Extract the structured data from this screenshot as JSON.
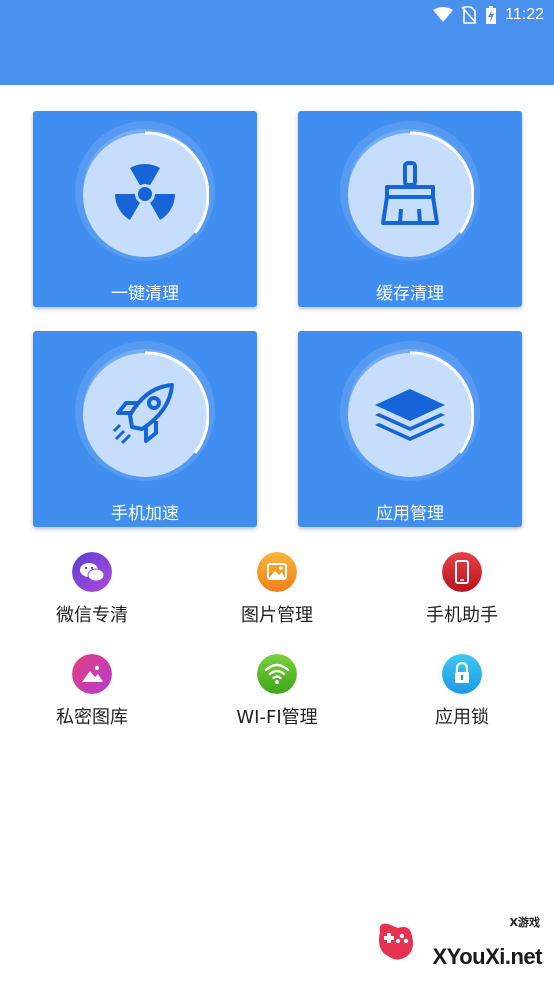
{
  "status_bar": {
    "time": "11:22",
    "background": "#4a90ef",
    "icons": [
      "wifi-icon",
      "no-sim-icon",
      "battery-charging-icon"
    ]
  },
  "main_cards": [
    {
      "label": "一键清理",
      "icon": "radiation-icon"
    },
    {
      "label": "缓存清理",
      "icon": "broom-icon"
    },
    {
      "label": "手机加速",
      "icon": "rocket-icon"
    },
    {
      "label": "应用管理",
      "icon": "layers-icon"
    }
  ],
  "tools": [
    {
      "label": "微信专清",
      "icon": "wechat-icon",
      "color": "#7a45d8"
    },
    {
      "label": "图片管理",
      "icon": "image-icon",
      "color": "#f39c1e"
    },
    {
      "label": "手机助手",
      "icon": "phone-icon",
      "color": "#d8262e"
    },
    {
      "label": "私密图库",
      "icon": "private-gallery-icon",
      "color": "#d8389a"
    },
    {
      "label": "WI-FI管理",
      "icon": "wifi-manage-icon",
      "color": "#5bbf2a"
    },
    {
      "label": "应用锁",
      "icon": "lock-icon",
      "color": "#27b6ef"
    }
  ],
  "watermark": {
    "small_text": "X游戏",
    "big_text": "XYouXi.net"
  },
  "colors": {
    "card_blue": "#3f8ef0",
    "accent_blue": "#1565d8"
  }
}
